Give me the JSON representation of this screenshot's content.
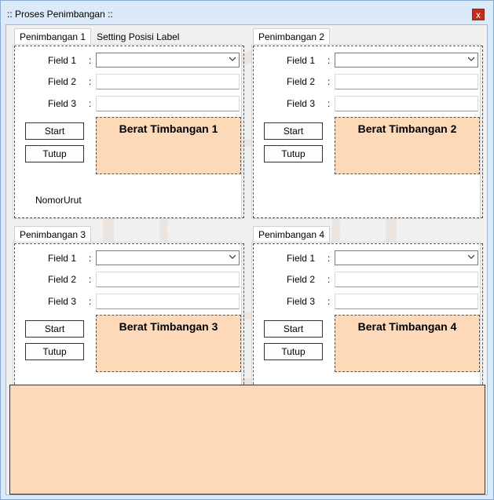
{
  "window": {
    "title": ":: Proses Penimbangan ::",
    "close_label": "x"
  },
  "groups": [
    {
      "tabs": [
        "Penimbangan 1",
        "Setting Posisi Label"
      ],
      "fields": [
        {
          "label": "Field 1",
          "sep": ":"
        },
        {
          "label": "Field 2",
          "sep": ":"
        },
        {
          "label": "Field 3",
          "sep": ":"
        }
      ],
      "start_label": "Start",
      "close_label": "Tutup",
      "weight_label": "Berat Timbangan 1",
      "nomor_label": "NomorUrut"
    },
    {
      "tabs": [
        "Penimbangan 2"
      ],
      "fields": [
        {
          "label": "Field 1",
          "sep": ":"
        },
        {
          "label": "Field 2",
          "sep": ":"
        },
        {
          "label": "Field 3",
          "sep": ":"
        }
      ],
      "start_label": "Start",
      "close_label": "Tutup",
      "weight_label": "Berat Timbangan 2"
    },
    {
      "tabs": [
        "Penimbangan 3"
      ],
      "fields": [
        {
          "label": "Field 1",
          "sep": ":"
        },
        {
          "label": "Field 2",
          "sep": ":"
        },
        {
          "label": "Field 3",
          "sep": ":"
        }
      ],
      "start_label": "Start",
      "close_label": "Tutup",
      "weight_label": "Berat Timbangan 3"
    },
    {
      "tabs": [
        "Penimbangan 4"
      ],
      "fields": [
        {
          "label": "Field 1",
          "sep": ":"
        },
        {
          "label": "Field 2",
          "sep": ":"
        },
        {
          "label": "Field 3",
          "sep": ":"
        }
      ],
      "start_label": "Start",
      "close_label": "Tutup",
      "weight_label": "Berat Timbangan 4"
    }
  ],
  "colors": {
    "weight_panel": "#fdd9b9",
    "window_frame": "#dce9f8",
    "close_button": "#c42b1c"
  },
  "icons": {
    "close": "close-icon",
    "combo_arrow": "chevron-down-icon"
  }
}
